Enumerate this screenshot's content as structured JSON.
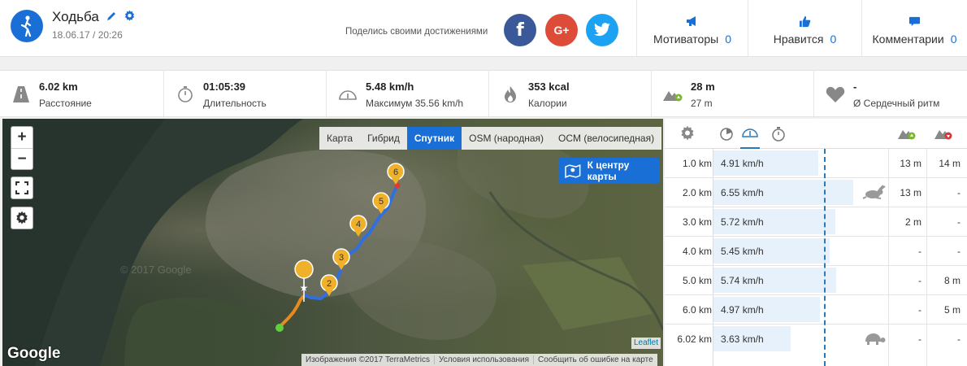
{
  "header": {
    "title": "Ходьба",
    "datetime": "18.06.17 / 20:26",
    "share_text": "Поделись своими достижениями",
    "social": [
      {
        "name": "facebook",
        "glyph": "f",
        "color": "#3b5998"
      },
      {
        "name": "google-plus",
        "glyph": "G+",
        "color": "#dd4b39"
      },
      {
        "name": "twitter",
        "color": "#1da1f2"
      }
    ],
    "counters": [
      {
        "label": "Мотиваторы",
        "count": "0",
        "icon": "megaphone-icon"
      },
      {
        "label": "Нравится",
        "count": "0",
        "icon": "thumbs-up-icon"
      },
      {
        "label": "Комментарии",
        "count": "0",
        "icon": "comment-icon"
      }
    ]
  },
  "stats": [
    {
      "value": "6.02 km",
      "label": "Расстояние",
      "icon": "road-icon"
    },
    {
      "value": "01:05:39",
      "label": "Длительность",
      "icon": "stopwatch-icon"
    },
    {
      "value": "5.48 km/h",
      "label": "Максимум 35.56 km/h",
      "icon": "speedometer-icon"
    },
    {
      "value": "353 kcal",
      "label": "Калории",
      "icon": "flame-icon"
    },
    {
      "value": "28 m",
      "label": "27 m",
      "icon": "elevation-icon"
    },
    {
      "value": "-",
      "label": "Ø Сердечный ритм",
      "icon": "heart-icon"
    }
  ],
  "map": {
    "zoom_in": "+",
    "zoom_out": "−",
    "layers": [
      "Карта",
      "Гибрид",
      "Спутник",
      "OSM (народная)",
      "OCM (велосипедная)"
    ],
    "active_layer": "Спутник",
    "center_button": "К центру карты",
    "google_label": "Google",
    "watermark": "© 2017 Google",
    "attribution": [
      "Изображения ©2017 TerraMetrics",
      "Условия использования",
      "Сообщить об ошибке на карте"
    ],
    "leaflet": "Leaflet",
    "km_markers": [
      "2",
      "3",
      "4",
      "5",
      "6"
    ]
  },
  "splits": {
    "rows": [
      {
        "distance": "1.0 km",
        "speed": "4.91 km/h",
        "speed_value": 4.91,
        "up": "13 m",
        "down": "14 m",
        "badge": ""
      },
      {
        "distance": "2.0 km",
        "speed": "6.55 km/h",
        "speed_value": 6.55,
        "up": "13 m",
        "down": "-",
        "badge": "rabbit"
      },
      {
        "distance": "3.0 km",
        "speed": "5.72 km/h",
        "speed_value": 5.72,
        "up": "2 m",
        "down": "-",
        "badge": ""
      },
      {
        "distance": "4.0 km",
        "speed": "5.45 km/h",
        "speed_value": 5.45,
        "up": "-",
        "down": "-",
        "badge": ""
      },
      {
        "distance": "5.0 km",
        "speed": "5.74 km/h",
        "speed_value": 5.74,
        "up": "-",
        "down": "8 m",
        "badge": ""
      },
      {
        "distance": "6.0 km",
        "speed": "4.97 km/h",
        "speed_value": 4.97,
        "up": "-",
        "down": "5 m",
        "badge": ""
      },
      {
        "distance": "6.02 km",
        "speed": "3.63 km/h",
        "speed_value": 3.63,
        "up": "-",
        "down": "-",
        "badge": "turtle"
      }
    ]
  }
}
